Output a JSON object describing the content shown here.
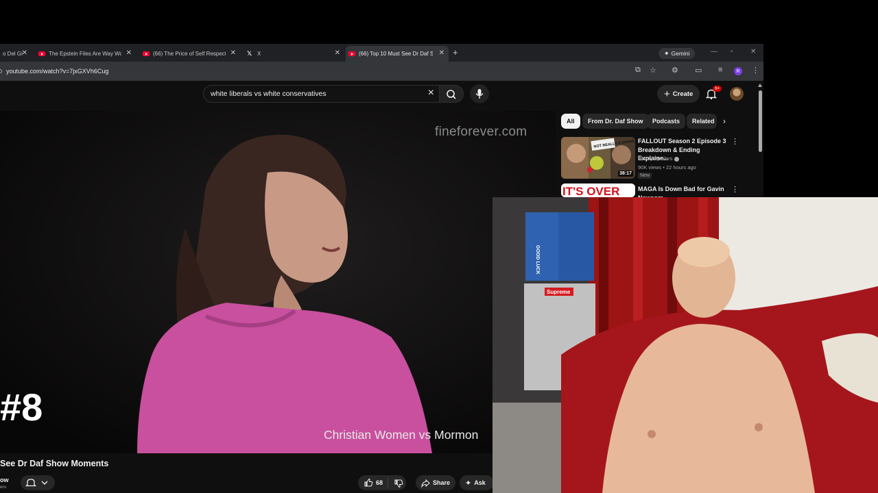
{
  "browser": {
    "tabs": [
      {
        "title": "o Del Gi",
        "favicon": "youtube-icon",
        "active": false
      },
      {
        "title": "The Epstein Files Are Way Wors",
        "favicon": "youtube-icon",
        "active": false
      },
      {
        "title": "(66) The Price of Self Respect -",
        "favicon": "youtube-icon",
        "active": false
      },
      {
        "title": "X",
        "favicon": "x-logo-icon",
        "active": false
      },
      {
        "title": "(66) Top 10 Must See Dr Daf Sh",
        "favicon": "youtube-icon",
        "active": true
      }
    ],
    "gemini_label": "Gemini",
    "url": "youtube.com/watch?v=7jxGXVh6Cug",
    "profile_initial": "R"
  },
  "youtube": {
    "search_query": "white liberals vs white conservatives",
    "create_label": "Create",
    "notification_count": "9+",
    "video": {
      "watermark": "fineforever.com",
      "rank": "#8",
      "caption": "Christian Women vs Mormon",
      "title": "See Dr Daf Show Moments",
      "channel": "ow",
      "subscribers": "ers",
      "likes": "68",
      "share_label": "Share",
      "ask_label": "Ask"
    },
    "chips": [
      "All",
      "From Dr. Daf Show",
      "Podcasts",
      "Related"
    ],
    "recommendations": [
      {
        "title": "FALLOUT Season 2 Episode 3 Breakdown & Ending Explaine...",
        "channel": "Heavy Spoilers",
        "meta": "90K views • 22 hours ago",
        "badge": "New",
        "duration": "38:17",
        "thumb_text": "NOT REALLY A GHOUL?"
      },
      {
        "title": "MAGA Is Down Bad for Gavin Newsom",
        "thumb_text": "IT'S OVER"
      }
    ]
  },
  "webcam": {
    "box_label": "GOOD LUCK",
    "sticker_label": "Supreme"
  }
}
